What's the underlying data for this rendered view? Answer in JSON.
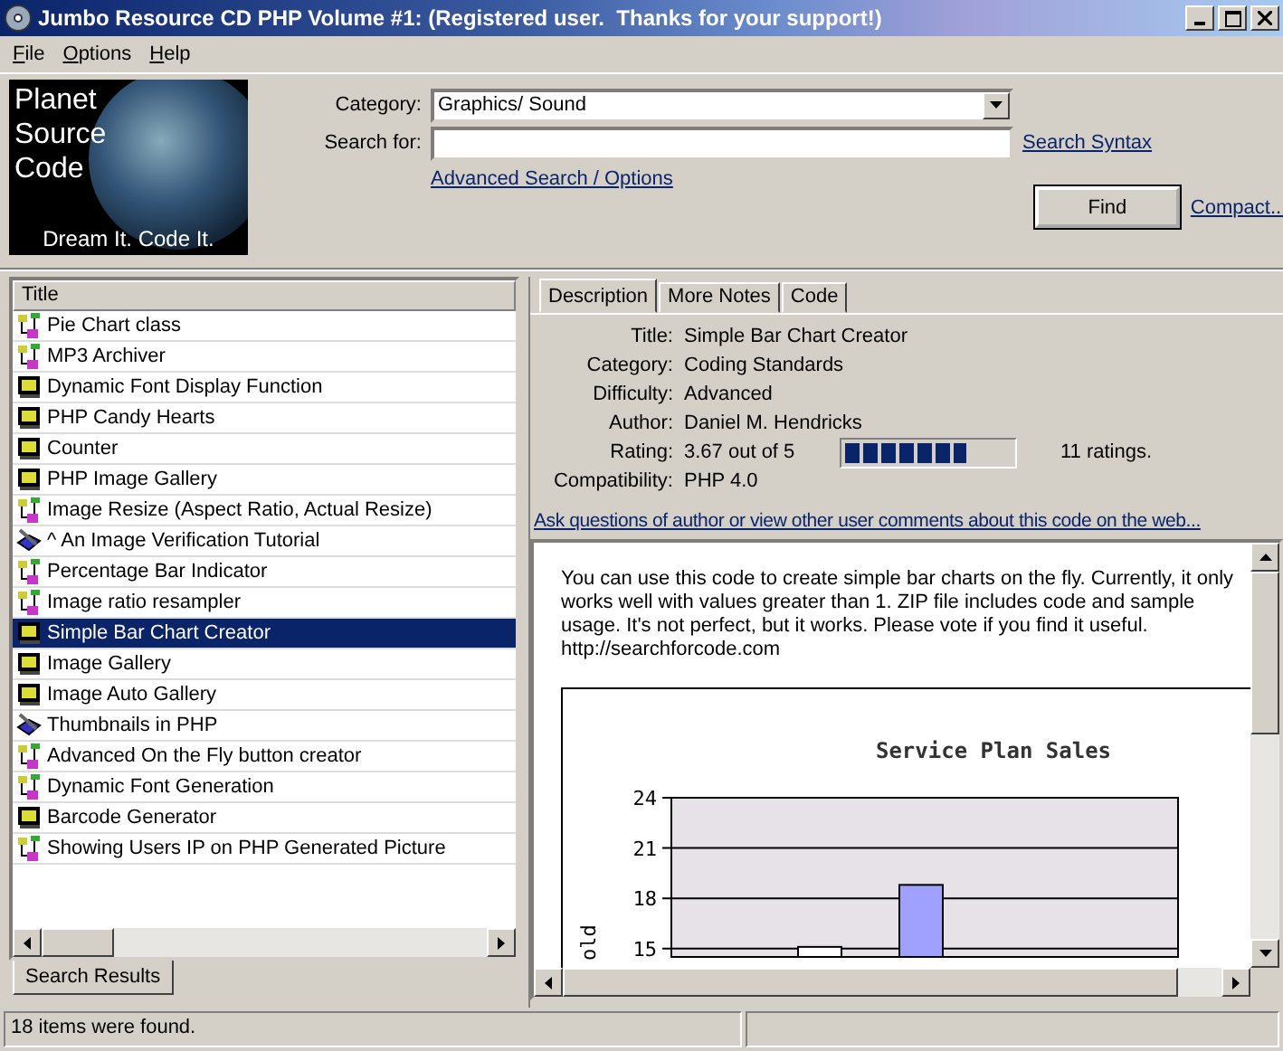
{
  "window": {
    "title": "Jumbo Resource CD PHP Volume #1: (Registered user.  Thanks for your support!)"
  },
  "menu": [
    {
      "label": "File"
    },
    {
      "label": "Options"
    },
    {
      "label": "Help"
    }
  ],
  "logo": {
    "lines": [
      "Planet",
      "Source",
      "Code"
    ],
    "tagline": "Dream It.  Code It."
  },
  "search": {
    "category_label": "Category:",
    "category_value": "Graphics/ Sound",
    "search_label": "Search for:",
    "search_syntax_link": "Search Syntax",
    "advanced_link": "Advanced Search / Options",
    "find_button": "Find",
    "compact_link": "Compact..."
  },
  "results": {
    "column": "Title",
    "rows": [
      {
        "title": "Pie Chart class",
        "kind": "diagram",
        "selected": false
      },
      {
        "title": "MP3 Archiver",
        "kind": "diagram",
        "selected": false
      },
      {
        "title": "Dynamic Font Display Function",
        "kind": "monitor",
        "selected": false
      },
      {
        "title": "PHP Candy Hearts",
        "kind": "monitor",
        "selected": false
      },
      {
        "title": "Counter",
        "kind": "monitor",
        "selected": false
      },
      {
        "title": "PHP Image Gallery",
        "kind": "monitor",
        "selected": false
      },
      {
        "title": "Image Resize (Aspect Ratio, Actual Resize)",
        "kind": "diagram",
        "selected": false
      },
      {
        "title": "^ An  Image Verification Tutorial",
        "kind": "book",
        "selected": false
      },
      {
        "title": "Percentage Bar Indicator",
        "kind": "diagram",
        "selected": false
      },
      {
        "title": "Image ratio resampler",
        "kind": "diagram",
        "selected": false
      },
      {
        "title": "Simple Bar Chart Creator",
        "kind": "monitor",
        "selected": true
      },
      {
        "title": "Image Gallery",
        "kind": "monitor",
        "selected": false
      },
      {
        "title": "Image Auto Gallery",
        "kind": "monitor",
        "selected": false
      },
      {
        "title": "Thumbnails in PHP",
        "kind": "book",
        "selected": false
      },
      {
        "title": "Advanced On the Fly button creator",
        "kind": "diagram",
        "selected": false
      },
      {
        "title": "Dynamic Font Generation",
        "kind": "diagram",
        "selected": false
      },
      {
        "title": "Barcode Generator",
        "kind": "monitor",
        "selected": false
      },
      {
        "title": "Showing Users IP on PHP Generated Picture",
        "kind": "diagram",
        "selected": false
      }
    ],
    "tab": "Search Results"
  },
  "detail_tabs": [
    {
      "label": "Description",
      "selected": true
    },
    {
      "label": "More Notes",
      "selected": false
    },
    {
      "label": "Code",
      "selected": false
    }
  ],
  "details": [
    {
      "label": "Title:",
      "value": "Simple Bar Chart Creator"
    },
    {
      "label": "Category:",
      "value": "Coding Standards"
    },
    {
      "label": "Difficulty:",
      "value": "Advanced"
    },
    {
      "label": "Author:",
      "value": "Daniel M. Hendricks"
    },
    {
      "label": "Rating:",
      "value": "3.67 out of 5",
      "kind": "rating",
      "level": 0.73,
      "count": "11 ratings."
    },
    {
      "label": "Compatibility:",
      "value": "PHP 4.0"
    }
  ],
  "comments_link": "Ask questions of author or view other user comments about this code on the web...",
  "description": "You can use this code to create simple bar charts on the fly. Currently, it only works well with values greater than 1. ZIP file includes code and sample usage. It's not perfect, but it works. Please vote if you find it useful.",
  "url": "http://searchforcode.com",
  "chart_data": {
    "type": "bar",
    "title": "Service Plan Sales",
    "ylabel": "old",
    "yticks": [
      15,
      18,
      21,
      24
    ],
    "ylim": [
      14.5,
      24
    ],
    "grid": true,
    "values": [
      15.1,
      18.8
    ]
  },
  "status_bar": "18 items were found."
}
